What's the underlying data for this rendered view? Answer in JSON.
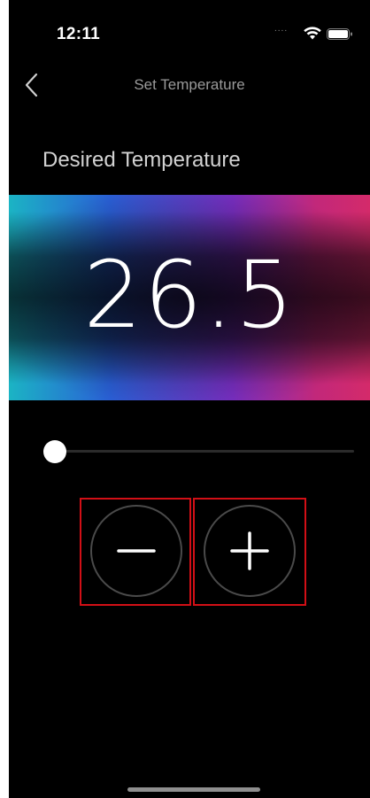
{
  "status_bar": {
    "time": "12:11",
    "signal_dots": "....",
    "wifi_icon": "wifi-icon",
    "battery_icon": "battery-icon"
  },
  "nav": {
    "back_icon": "chevron-left-icon",
    "title": "Set Temperature"
  },
  "main": {
    "heading": "Desired Temperature",
    "temperature_value": "26.5",
    "slider_level": 0.0,
    "decrement_icon": "minus-icon",
    "increment_icon": "plus-icon"
  },
  "colors": {
    "background": "#000000",
    "highlight_border": "#d20f16",
    "gradient_start": "#1bb4c4",
    "gradient_mid": "#7a2fc4",
    "gradient_end": "#d42a6a"
  }
}
